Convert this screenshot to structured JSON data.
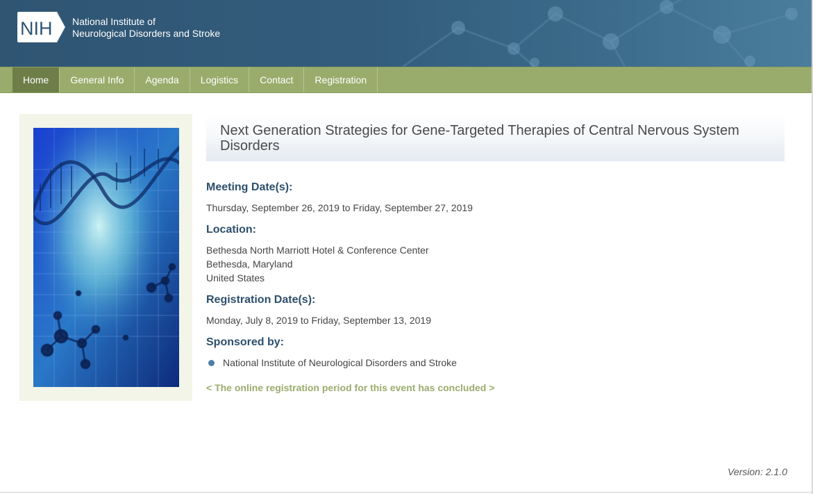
{
  "header": {
    "logo_badge": "NIH",
    "org_line1": "National Institute of",
    "org_line2": "Neurological Disorders and Stroke"
  },
  "nav": {
    "items": [
      {
        "label": "Home",
        "active": true
      },
      {
        "label": "General Info"
      },
      {
        "label": "Agenda"
      },
      {
        "label": "Logistics"
      },
      {
        "label": "Contact"
      },
      {
        "label": "Registration"
      }
    ]
  },
  "event": {
    "title": "Next Generation Strategies for Gene-Targeted Therapies of Central Nervous System Disorders",
    "meeting_label": "Meeting Date(s):",
    "meeting_dates": "Thursday, September 26, 2019 to Friday, September 27, 2019",
    "location_label": "Location:",
    "location_line1": "Bethesda North Marriott Hotel & Conference Center",
    "location_line2": "Bethesda, Maryland",
    "location_line3": "United States",
    "registration_label": "Registration Date(s):",
    "registration_dates": "Monday, July 8, 2019 to Friday, September 13, 2019",
    "sponsored_label": "Sponsored by:",
    "sponsors": [
      "National Institute of Neurological Disorders and Stroke"
    ],
    "registration_note": "< The online registration period for this event has concluded >"
  },
  "footer": {
    "version": "Version: 2.1.0"
  },
  "colors": {
    "header_blue": "#335c7c",
    "nav_green": "#9aac6c",
    "nav_active": "#6e7e48",
    "label_blue": "#2c4f6c",
    "note_green": "#9aac6c"
  }
}
